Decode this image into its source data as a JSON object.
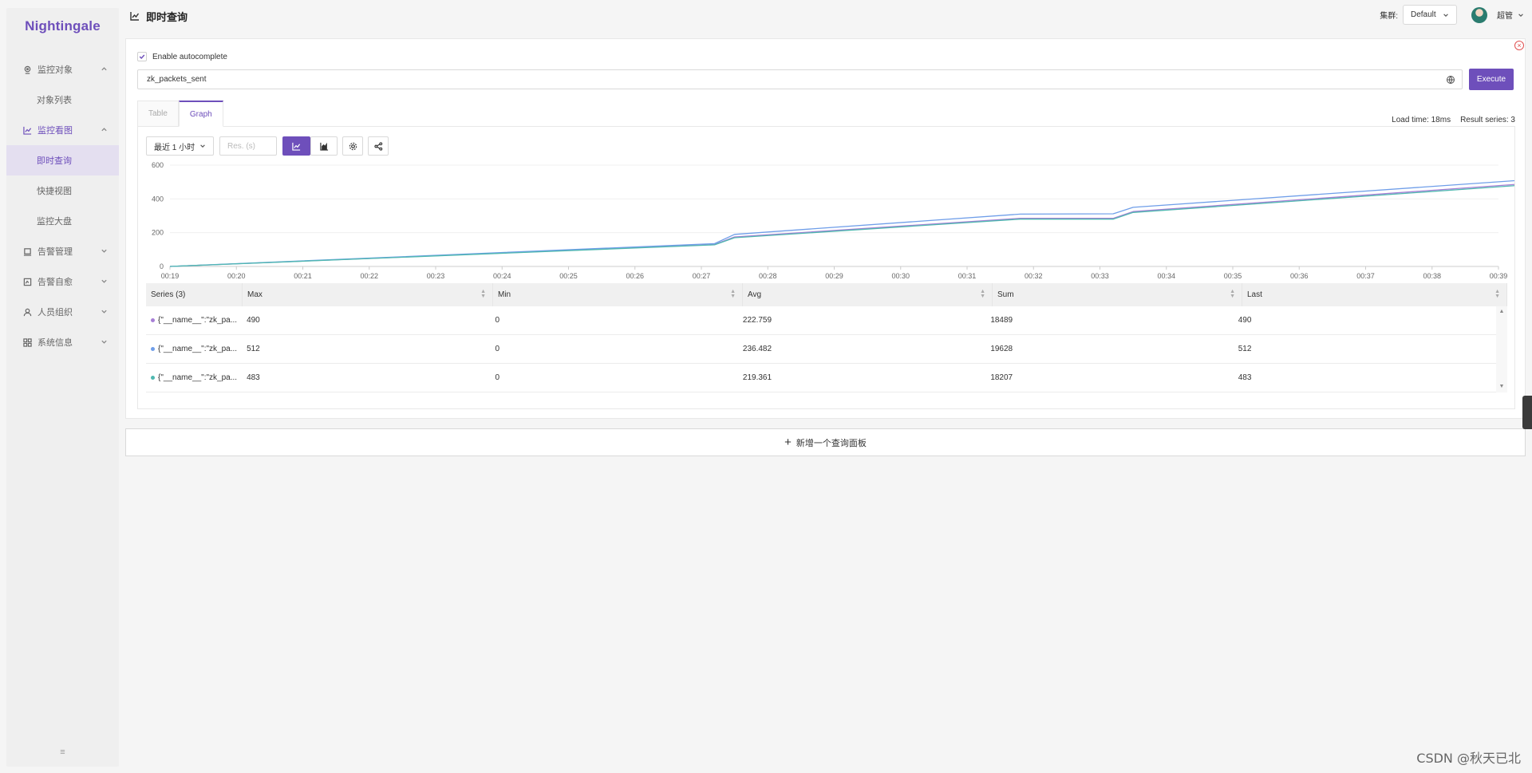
{
  "app": {
    "logo": "Nightingale"
  },
  "sidebar": {
    "groups": [
      {
        "label": "监控对象",
        "icon": "target-icon",
        "expanded": true,
        "items": [
          {
            "label": "对象列表"
          }
        ]
      },
      {
        "label": "监控看图",
        "icon": "line-chart-icon",
        "expanded": true,
        "items": [
          {
            "label": "即时查询"
          },
          {
            "label": "快捷视图"
          },
          {
            "label": "监控大盘"
          }
        ]
      },
      {
        "label": "告警管理",
        "icon": "alarm-icon",
        "expanded": false
      },
      {
        "label": "告警自愈",
        "icon": "heal-icon",
        "expanded": false
      },
      {
        "label": "人员组织",
        "icon": "user-icon",
        "expanded": false
      },
      {
        "label": "系统信息",
        "icon": "grid-icon",
        "expanded": false
      }
    ],
    "collapse_icon": "≡"
  },
  "header": {
    "title": "即时查询",
    "cluster_label": "集群:",
    "cluster_value": "Default",
    "user_name": "超管"
  },
  "query": {
    "autocomplete_label": "Enable autocomplete",
    "autocomplete_checked": true,
    "expression": "zk_packets_sent",
    "execute_label": "Execute",
    "tabs": [
      {
        "label": "Table"
      },
      {
        "label": "Graph",
        "active": true
      }
    ],
    "load_time": "Load time: 18ms",
    "result_series": "Result series: 3",
    "time_range": "最近 1 小时",
    "res_placeholder": "Res. (s)"
  },
  "chart_data": {
    "type": "line",
    "ylim": [
      0,
      600
    ],
    "yticks": [
      "0",
      "200",
      "400",
      "600"
    ],
    "x": [
      "00:19",
      "00:20",
      "00:21",
      "00:22",
      "00:23",
      "00:24",
      "00:25",
      "00:26",
      "00:27",
      "00:28",
      "00:29",
      "00:30",
      "00:31",
      "00:32",
      "00:33",
      "00:34",
      "00:35",
      "00:36",
      "00:37",
      "00:38",
      "00:39"
    ],
    "series": [
      {
        "color": "#a77fd6",
        "points": [
          [
            0,
            0
          ],
          [
            8.2,
            130
          ],
          [
            8.5,
            175
          ],
          [
            12.8,
            285
          ],
          [
            14.2,
            285
          ],
          [
            14.5,
            325
          ],
          [
            20.4,
            490
          ]
        ]
      },
      {
        "color": "#6f9ee9",
        "points": [
          [
            0,
            0
          ],
          [
            8.2,
            135
          ],
          [
            8.5,
            190
          ],
          [
            12.8,
            310
          ],
          [
            14.2,
            312
          ],
          [
            14.5,
            350
          ],
          [
            20.4,
            512
          ]
        ]
      },
      {
        "color": "#4fb8b0",
        "points": [
          [
            0,
            0
          ],
          [
            8.2,
            128
          ],
          [
            8.5,
            170
          ],
          [
            12.8,
            280
          ],
          [
            14.2,
            280
          ],
          [
            14.5,
            320
          ],
          [
            20.4,
            483
          ]
        ]
      }
    ]
  },
  "table": {
    "headers": [
      "Series (3)",
      "Max",
      "Min",
      "Avg",
      "Sum",
      "Last"
    ],
    "rows": [
      {
        "color": "#a77fd6",
        "series": "{\"__name__\":\"zk_pa...",
        "max": "490",
        "min": "0",
        "avg": "222.759",
        "sum": "18489",
        "last": "490"
      },
      {
        "color": "#6f9ee9",
        "series": "{\"__name__\":\"zk_pa...",
        "max": "512",
        "min": "0",
        "avg": "236.482",
        "sum": "19628",
        "last": "512"
      },
      {
        "color": "#4fb8b0",
        "series": "{\"__name__\":\"zk_pa...",
        "max": "483",
        "min": "0",
        "avg": "219.361",
        "sum": "18207",
        "last": "483"
      }
    ]
  },
  "add_panel_label": "新增一个查询面板",
  "watermark": "CSDN @秋天已北",
  "colors": {
    "accent": "#6e4fbb"
  }
}
